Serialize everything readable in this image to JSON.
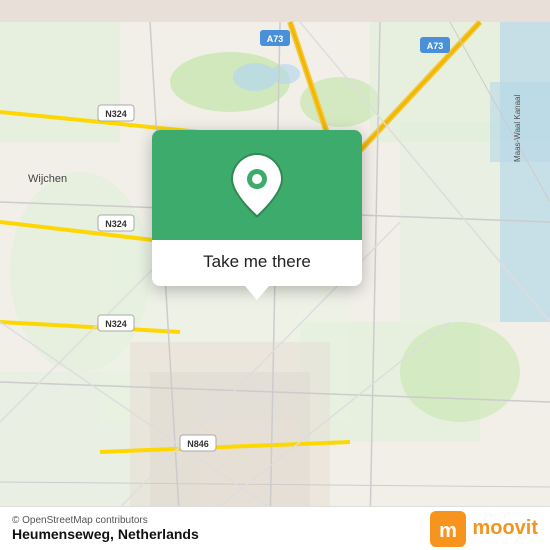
{
  "map": {
    "attribution": "© OpenStreetMap contributors",
    "background_color": "#e8e0d8"
  },
  "popup": {
    "button_label": "Take me there",
    "pin_color": "#ffffff",
    "bg_color": "#3dab6b"
  },
  "bottom_bar": {
    "location_name": "Heumenseweg,",
    "location_country": "Netherlands",
    "logo_text": "moovit"
  },
  "road_labels": {
    "n324_1": "N324",
    "n324_2": "N324",
    "n324_3": "N324",
    "n846": "N846",
    "a73_1": "A73",
    "a73_2": "A73",
    "wijchen": "Wijchen"
  }
}
